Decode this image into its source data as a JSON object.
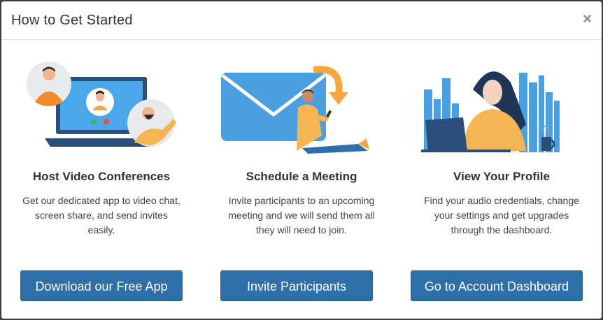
{
  "modal": {
    "title": "How to Get Started",
    "close_glyph": "×"
  },
  "columns": [
    {
      "heading": "Host Video Conferences",
      "description": "Get our dedicated app to video chat, screen share, and send invites easily.",
      "button_label": "Download our Free App",
      "illustration": "video-conference-illustration"
    },
    {
      "heading": "Schedule a Meeting",
      "description": "Invite participants to an upcoming meeting and we will send them all they will need to join.",
      "button_label": "Invite Participants",
      "illustration": "envelope-invite-illustration"
    },
    {
      "heading": "View Your Profile",
      "description": "Find your audio credentials, change your settings and get upgrades through the dashboard.",
      "button_label": "Go to Account Dashboard",
      "illustration": "profile-dashboard-illustration"
    }
  ],
  "colors": {
    "accent": "#2d6fa8",
    "illustration_blue": "#4a9fe0",
    "illustration_orange": "#f5a742"
  }
}
